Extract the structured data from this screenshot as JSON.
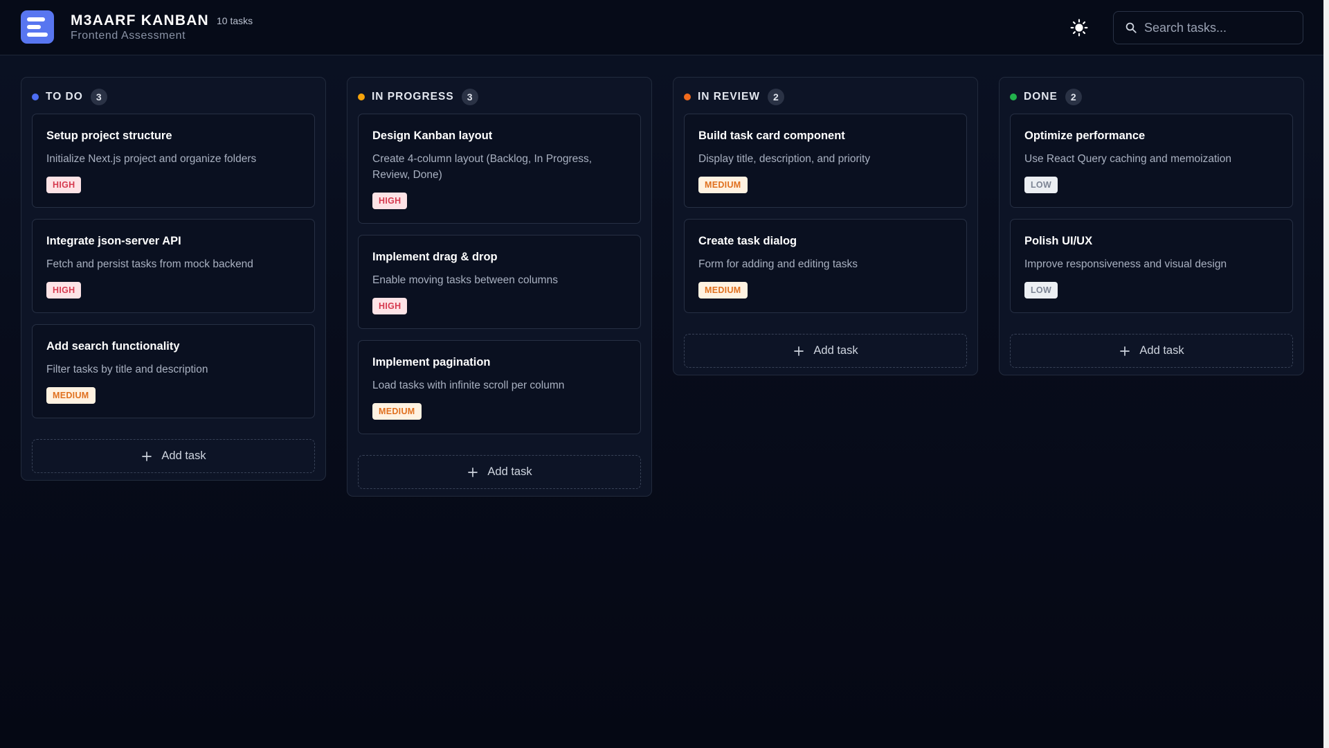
{
  "header": {
    "title": "M3AARF KANBAN",
    "task_count": "10 tasks",
    "subtitle": "Frontend Assessment",
    "search_placeholder": "Search tasks..."
  },
  "columns": [
    {
      "title": "TO DO",
      "count": "3",
      "dot_color": "#4d6ef5",
      "add_label": "Add task",
      "cards": [
        {
          "title": "Setup project structure",
          "desc": "Initialize Next.js project and organize folders",
          "priority": "HIGH"
        },
        {
          "title": "Integrate json-server API",
          "desc": "Fetch and persist tasks from mock backend",
          "priority": "HIGH"
        },
        {
          "title": "Add search functionality",
          "desc": "Filter tasks by title and description",
          "priority": "MEDIUM"
        }
      ]
    },
    {
      "title": "IN PROGRESS",
      "count": "3",
      "dot_color": "#f5a30b",
      "add_label": "Add task",
      "cards": [
        {
          "title": "Design Kanban layout",
          "desc": "Create 4-column layout (Backlog, In Progress, Review, Done)",
          "priority": "HIGH"
        },
        {
          "title": "Implement drag & drop",
          "desc": "Enable moving tasks between columns",
          "priority": "HIGH"
        },
        {
          "title": "Implement pagination",
          "desc": "Load tasks with infinite scroll per column",
          "priority": "MEDIUM"
        }
      ]
    },
    {
      "title": "IN REVIEW",
      "count": "2",
      "dot_color": "#f06a1d",
      "add_label": "Add task",
      "cards": [
        {
          "title": "Build task card component",
          "desc": "Display title, description, and priority",
          "priority": "MEDIUM"
        },
        {
          "title": "Create task dialog",
          "desc": "Form for adding and editing tasks",
          "priority": "MEDIUM"
        }
      ]
    },
    {
      "title": "DONE",
      "count": "2",
      "dot_color": "#22b24c",
      "add_label": "Add task",
      "cards": [
        {
          "title": "Optimize performance",
          "desc": "Use React Query caching and memoization",
          "priority": "LOW"
        },
        {
          "title": "Polish UI/UX",
          "desc": "Improve responsiveness and visual design",
          "priority": "LOW"
        }
      ]
    }
  ],
  "icons": {
    "logo": "kanban-logo-icon",
    "theme": "sun-icon",
    "search": "search-icon",
    "add": "plus-icon"
  }
}
